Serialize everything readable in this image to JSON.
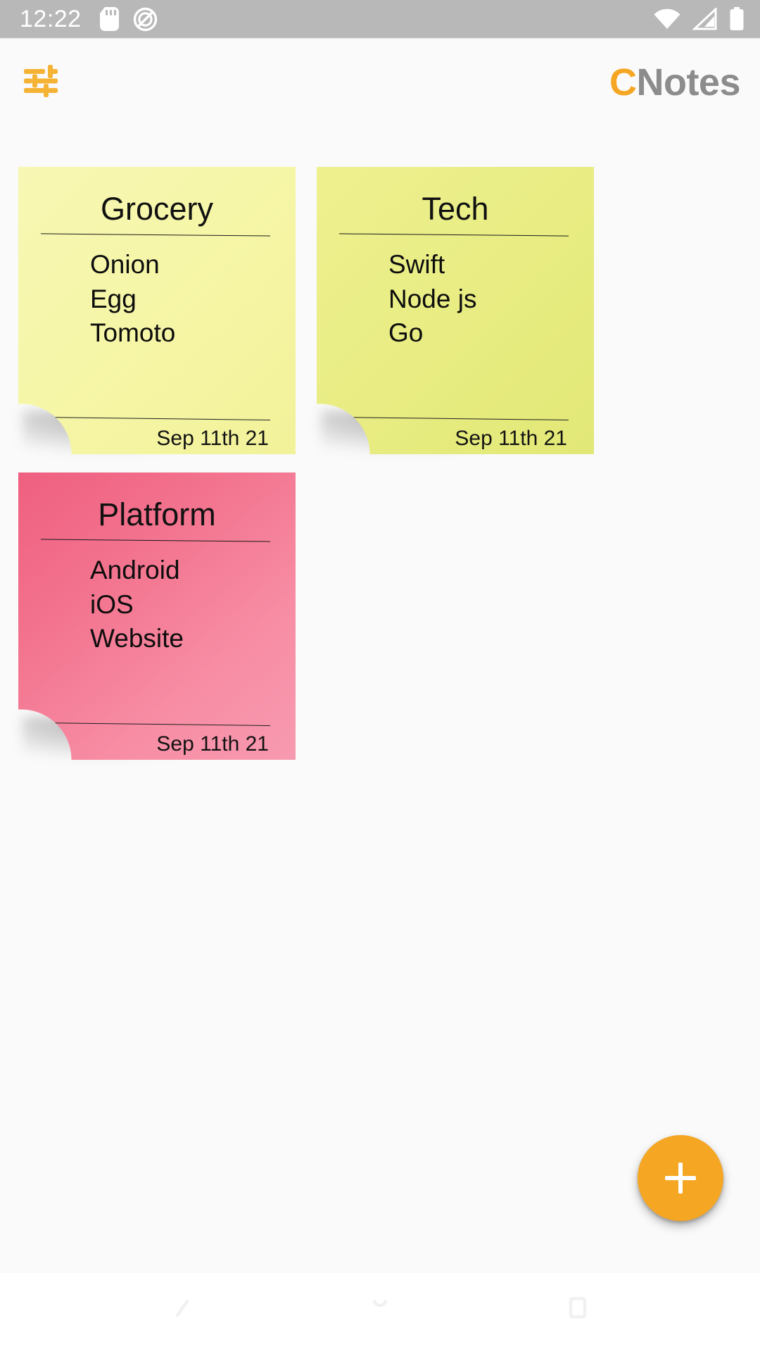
{
  "status_bar": {
    "time": "12:22",
    "left_icons": [
      "sd-card-icon",
      "do-not-disturb-icon"
    ],
    "right_icons": [
      "wifi-icon",
      "cellular-signal-icon",
      "battery-icon"
    ],
    "background_color": "#b8b8b8",
    "icon_color": "#ffffff"
  },
  "app_bar": {
    "filter_icon": "tune-sliders-icon",
    "title_accent": "C",
    "title_rest": "Notes",
    "accent_color": "#f5a623",
    "title_color": "#8c8c8c"
  },
  "notes": [
    {
      "title": "Grocery",
      "items": [
        "Onion",
        "Egg",
        "Tomoto"
      ],
      "date": "Sep 11th 21",
      "color": "yellow",
      "color_hex": "#f4f4a6"
    },
    {
      "title": "Tech",
      "items": [
        "Swift",
        "Node js",
        "Go"
      ],
      "date": "Sep 11th 21",
      "color": "lime",
      "color_hex": "#e8ed82"
    },
    {
      "title": "Platform",
      "items": [
        "Android",
        "iOS",
        "Website"
      ],
      "date": "Sep 11th 21",
      "color": "pink",
      "color_hex": "#f2708d"
    }
  ],
  "fab": {
    "icon": "plus-icon",
    "label": "+",
    "color": "#f5a623"
  },
  "nav_bar": {
    "buttons": [
      "back-icon",
      "home-icon",
      "recents-icon"
    ],
    "background_color": "#ffffff"
  }
}
